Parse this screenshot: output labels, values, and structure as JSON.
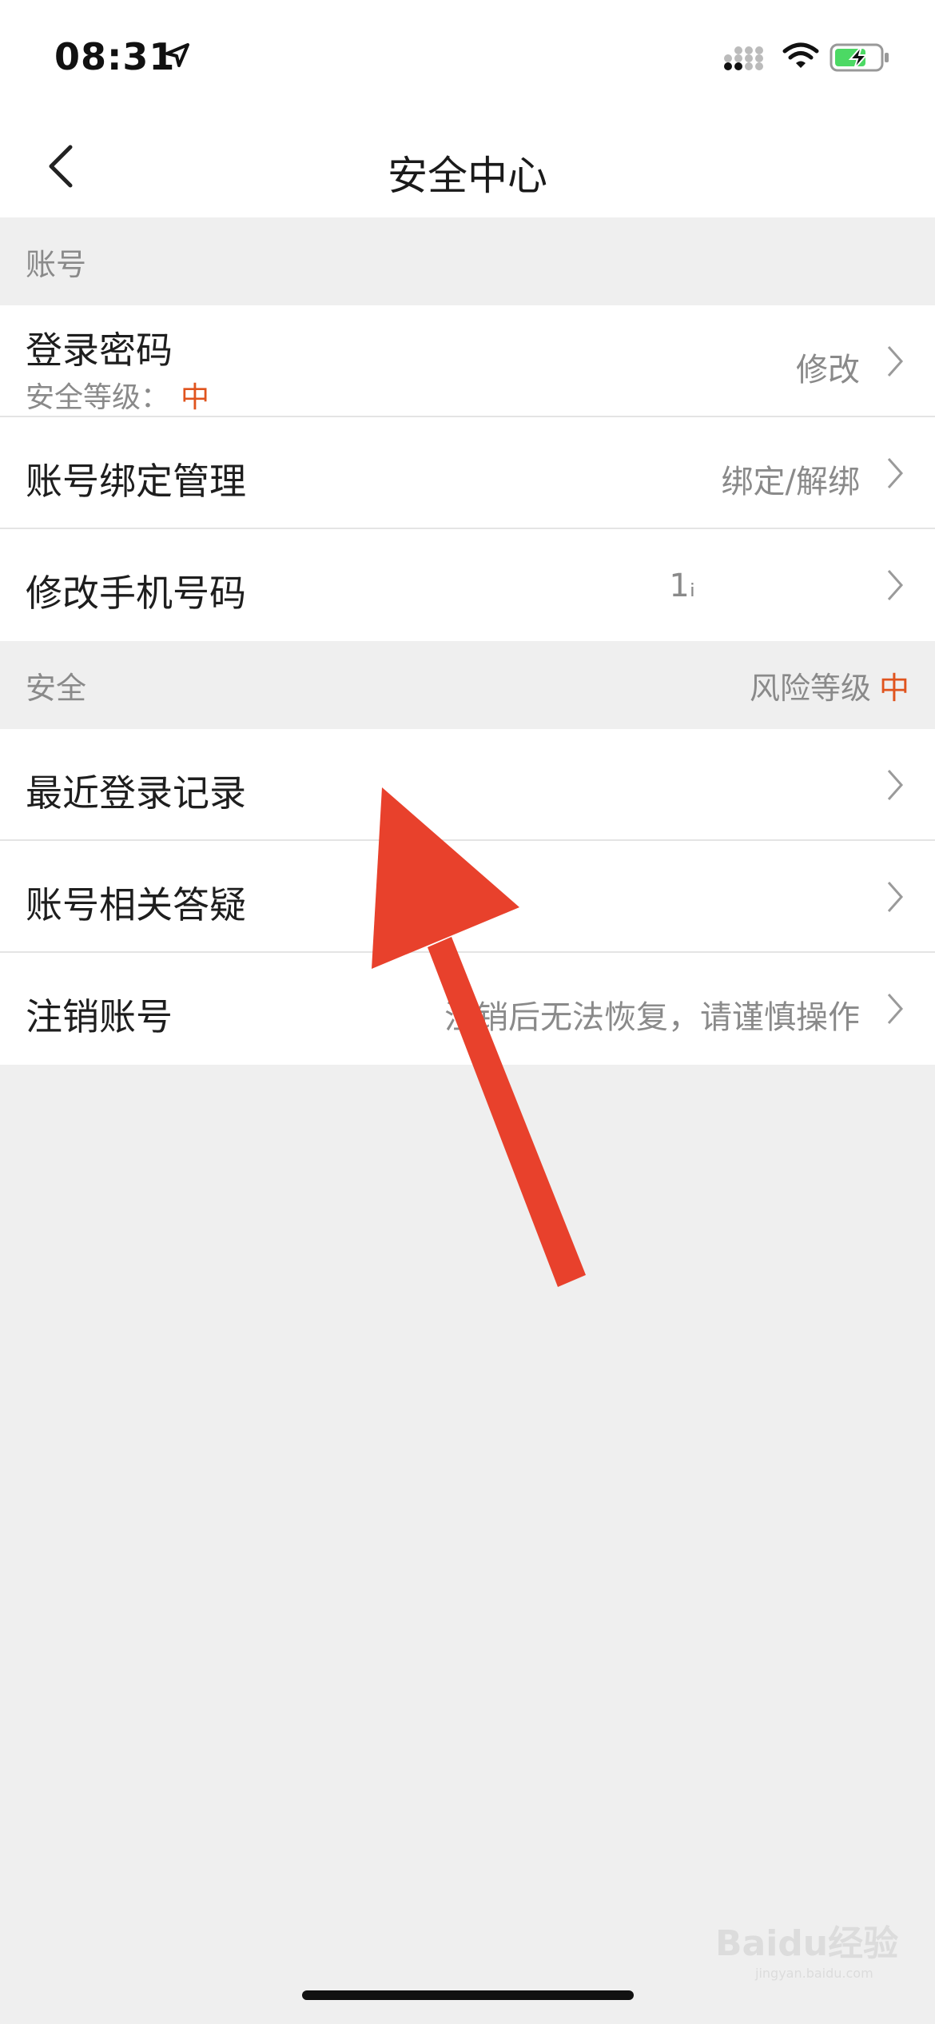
{
  "status": {
    "time": "08:31"
  },
  "nav": {
    "title": "安全中心",
    "back_icon": "chevron-left-icon"
  },
  "sections": {
    "account": {
      "header": "账号",
      "items": [
        {
          "title": "登录密码",
          "subtitle_label": "安全等级：",
          "subtitle_level": "中",
          "value": "修改"
        },
        {
          "title": "账号绑定管理",
          "value": "绑定/解绑"
        },
        {
          "title": "修改手机号码",
          "value": "1ᵢ"
        }
      ]
    },
    "security": {
      "header": "安全",
      "risk_label": "风险等级",
      "risk_level": "中",
      "items": [
        {
          "title": "最近登录记录",
          "value": ""
        },
        {
          "title": "账号相关答疑",
          "value": ""
        },
        {
          "title": "注销账号",
          "value": "注销后无法恢复，请谨慎操作"
        }
      ]
    }
  },
  "watermark": {
    "text": "Baidu经验",
    "sub": "jingyan.baidu.com"
  },
  "colors": {
    "accent": "#e0541e",
    "arrow": "#e8412c",
    "background": "#efefef"
  }
}
